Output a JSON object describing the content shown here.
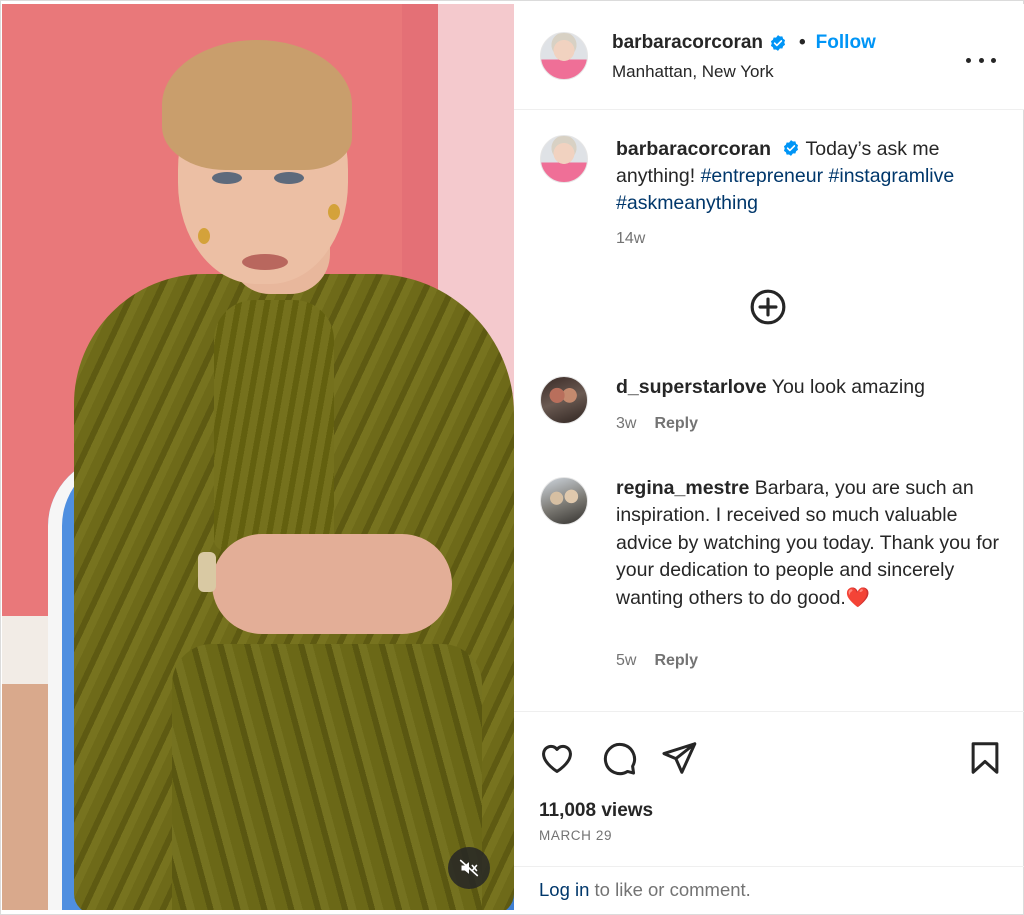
{
  "post": {
    "author": "barbaracorcoran",
    "follow_label": "Follow",
    "separator": "•",
    "location": "Manhattan, New York",
    "more_icon": "more-horizontal-icon"
  },
  "caption": {
    "author": "barbaracorcoran",
    "text": "Today’s ask me anything!",
    "hashtags": [
      "#entrepreneur",
      "#instagramlive",
      "#askmeanything"
    ],
    "time": "14w"
  },
  "comments": [
    {
      "username": "d_superstarlove",
      "text": "You look amazing",
      "time": "3w",
      "reply_label": "Reply"
    },
    {
      "username": "regina_mestre",
      "text": "Barbara, you are such an inspiration. I received so much valuable advice by watching you today. Thank you for your dedication to people and sincerely wanting others to do good.",
      "emoji": "❤️",
      "time": "5w",
      "reply_label": "Reply"
    }
  ],
  "stats": {
    "views": "11,008 views",
    "date": "MARCH 29"
  },
  "login": {
    "link": "Log in",
    "rest": "to like or comment."
  },
  "colors": {
    "accent": "#0095f6",
    "hashtag": "#00376b",
    "secondary_text": "#737373"
  },
  "icons": [
    "verified-badge-icon",
    "more-horizontal-icon",
    "plus-circle-icon",
    "heart-icon",
    "comment-icon",
    "share-icon",
    "bookmark-icon",
    "volume-off-icon"
  ]
}
